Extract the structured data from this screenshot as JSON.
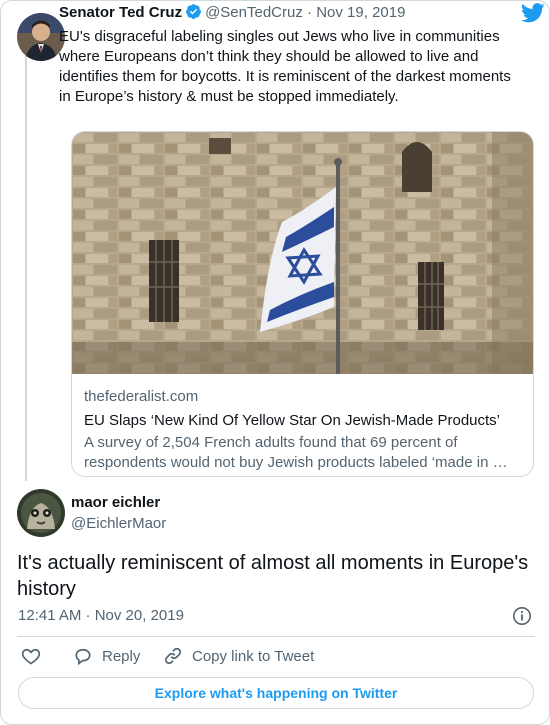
{
  "parent_tweet": {
    "author_name": "Senator Ted Cruz",
    "handle": "@SenTedCruz",
    "separator": "·",
    "date": "Nov 19, 2019",
    "text": "EU's disgraceful labeling singles out Jews who live in communities where Europeans don’t think they should be allowed to live and identifies them for boycotts. It is reminiscent of the darkest moments in Europe’s history & must be stopped immediately.",
    "link_card": {
      "domain": "thefederalist.com",
      "title": "EU Slaps ‘New Kind Of Yellow Star On Jewish-Made Products’",
      "description": "A survey of 2,504 French adults found that 69 percent of respondents would not buy Jewish products labeled ‘made in …"
    }
  },
  "main_tweet": {
    "author_name": "maor eichler",
    "handle": "@EichlerMaor",
    "text": "It's actually reminiscent of almost all moments in Europe's history",
    "time": "12:41 AM · Nov 20, 2019"
  },
  "actions": {
    "like_icon": "heart-icon",
    "reply_label": "Reply",
    "copy_link_label": "Copy link to Tweet"
  },
  "explore_label": "Explore what's happening on Twitter",
  "colors": {
    "twitter_blue": "#1d9bf0",
    "text_primary": "#0f1419",
    "text_secondary": "#536471",
    "border": "#cfd9de"
  }
}
